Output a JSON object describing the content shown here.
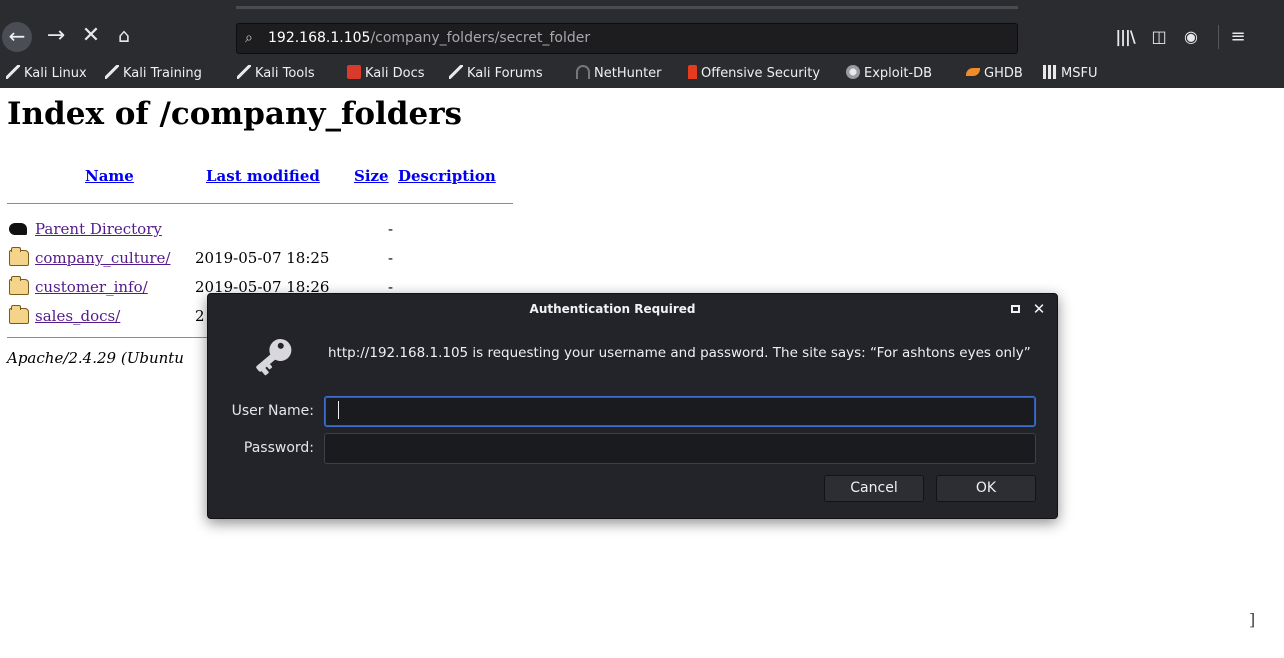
{
  "browser": {
    "url_host": "192.168.1.105",
    "url_path": "/company_folders/secret_folder",
    "nav_icons": [
      "back-arrow-icon",
      "forward-arrow-icon",
      "stop-icon",
      "home-icon"
    ],
    "toolbar_icons": [
      "library-icon",
      "sidebar-icon",
      "account-icon",
      "menu-icon"
    ],
    "bookmarks": [
      {
        "label": "Kali Linux",
        "icon": "kali-dragon-icon"
      },
      {
        "label": "Kali Training",
        "icon": "kali-dragon-icon"
      },
      {
        "label": "Kali Tools",
        "icon": "kali-dragon-icon"
      },
      {
        "label": "Kali Docs",
        "icon": "kali-docs-icon"
      },
      {
        "label": "Kali Forums",
        "icon": "kali-dragon-icon"
      },
      {
        "label": "NetHunter",
        "icon": "nethunter-icon"
      },
      {
        "label": "Offensive Security",
        "icon": "offsec-icon"
      },
      {
        "label": "Exploit-DB",
        "icon": "exploit-db-icon"
      },
      {
        "label": "GHDB",
        "icon": "ghdb-icon"
      },
      {
        "label": "MSFU",
        "icon": "msfu-icon"
      }
    ]
  },
  "page": {
    "title": "Index of /company_folders",
    "columns": {
      "name": "Name",
      "last_modified": "Last modified",
      "size": "Size",
      "description": "Description"
    },
    "rows": [
      {
        "name": "Parent Directory",
        "date": "",
        "size": "-",
        "icon": "back-icon"
      },
      {
        "name": "company_culture/",
        "date": "2019-05-07 18:25",
        "size": "-",
        "icon": "folder-icon"
      },
      {
        "name": "customer_info/",
        "date": "2019-05-07 18:26",
        "size": "-",
        "icon": "folder-icon"
      },
      {
        "name": "sales_docs/",
        "date": "2",
        "size": "",
        "icon": "folder-icon"
      }
    ],
    "footer": "Apache/2.4.29 (Ubuntu"
  },
  "dialog": {
    "title": "Authentication Required",
    "message": "http://192.168.1.105 is requesting your username and password. The site says: “For ashtons eyes only”",
    "username_label": "User Name:",
    "username_value": "",
    "password_label": "Password:",
    "password_value": "",
    "cancel_label": "Cancel",
    "ok_label": "OK"
  },
  "colors": {
    "chrome_bg": "#2b2c30",
    "dialog_bg": "#232429",
    "focus_ring": "#3f6fcb",
    "link": "#0000ee",
    "visited_link": "#551a8b"
  }
}
